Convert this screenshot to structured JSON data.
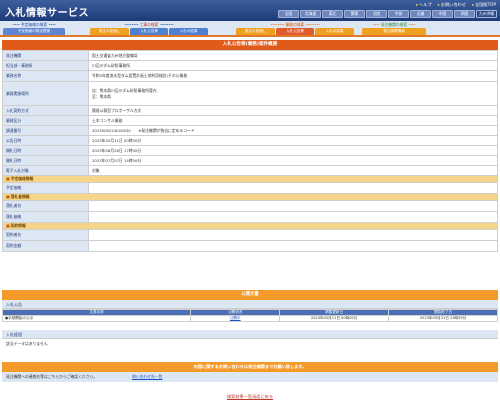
{
  "header": {
    "title": "入札情報サービス",
    "util_links": [
      "ヘルプ",
      "お問い合わせ",
      "全国版TOP"
    ],
    "regions": [
      "全国",
      "北海道",
      "東北",
      "関東",
      "北陸",
      "中部",
      "近畿",
      "中国",
      "四国",
      "九州沖縄"
    ],
    "active_region": "九州沖縄"
  },
  "nav": {
    "groups": [
      {
        "label": "予定価格の検索",
        "tabs": [
          "予定価格の算定根拠"
        ]
      },
      {
        "label": "工事の検索",
        "tabs": [
          "発注の見通し",
          "入札公告等",
          "入札の結果"
        ]
      },
      {
        "label": "業務の検索",
        "tabs": [
          "発注の見通し",
          "入札公告等",
          "入札の結果"
        ]
      },
      {
        "label": "発注機関の検索",
        "tabs": [
          "発注機関情報"
        ]
      }
    ]
  },
  "panel": {
    "title": "入札公告等(業務)案件概要",
    "rows": [
      {
        "label": "発注機関",
        "value": "国土交通省九州地方整備局"
      },
      {
        "label": "担当部・事務所",
        "value": "川辺川ダム砂防事務所"
      },
      {
        "label": "業務名称",
        "value": "令和5年度流水型ダム設置計画土地利用検討(その2)業務"
      },
      {
        "label": "業務実施場所",
        "value": "自：熊本県川辺川ダム砂防事務所管内",
        "value2": "至：熊本県"
      },
      {
        "label": "入札契約方式",
        "value": "簡易公募型プロポーザル方式"
      },
      {
        "label": "業務区分",
        "value": "土木コンサル業務"
      },
      {
        "label": "調達番号",
        "value": "2023005224002830　　※発注機関が独自に定めるコード"
      },
      {
        "label": "公告日時",
        "value": "2023年05月11日 00時00分"
      },
      {
        "label": "開札日時",
        "value": "2023年06月26日 17時00分"
      },
      {
        "label": "開札日時",
        "value": "2023年07月07日 14時00分"
      },
      {
        "label": "電子入札対象",
        "value": "対象"
      }
    ],
    "section_yotei": "予定価格情報",
    "yotei_label": "予定価格",
    "section_rakusatsu": "落札者情報",
    "rakusatsu_rows": [
      "落札者名",
      "落札価格"
    ],
    "section_keiyaku": "契約情報",
    "keiyaku_rows": [
      "契約者名",
      "契約金額"
    ]
  },
  "docs": {
    "title": "公開文書",
    "kokoku_head": "入札公告",
    "columns": [
      "文書名称",
      "公開状況",
      "掲載更新日",
      "閲覧終了日"
    ],
    "row": {
      "name": "手続開始の公示",
      "status": "公開中",
      "updated": "2023年05月11日 00時00分",
      "end": "2023年05月31日 23時59分"
    },
    "kekka_head": "入札経過",
    "no_data": "該当データはありません"
  },
  "footer": {
    "contact_bar": "内容に関するお問い合わせは発注機関までお願い致します。",
    "contact_text": "発注機関への連絡先等はこちらからご確認ください。",
    "contact_link": "問い合わせ先一覧",
    "back_link": "検索結果一覧画面に戻る"
  }
}
